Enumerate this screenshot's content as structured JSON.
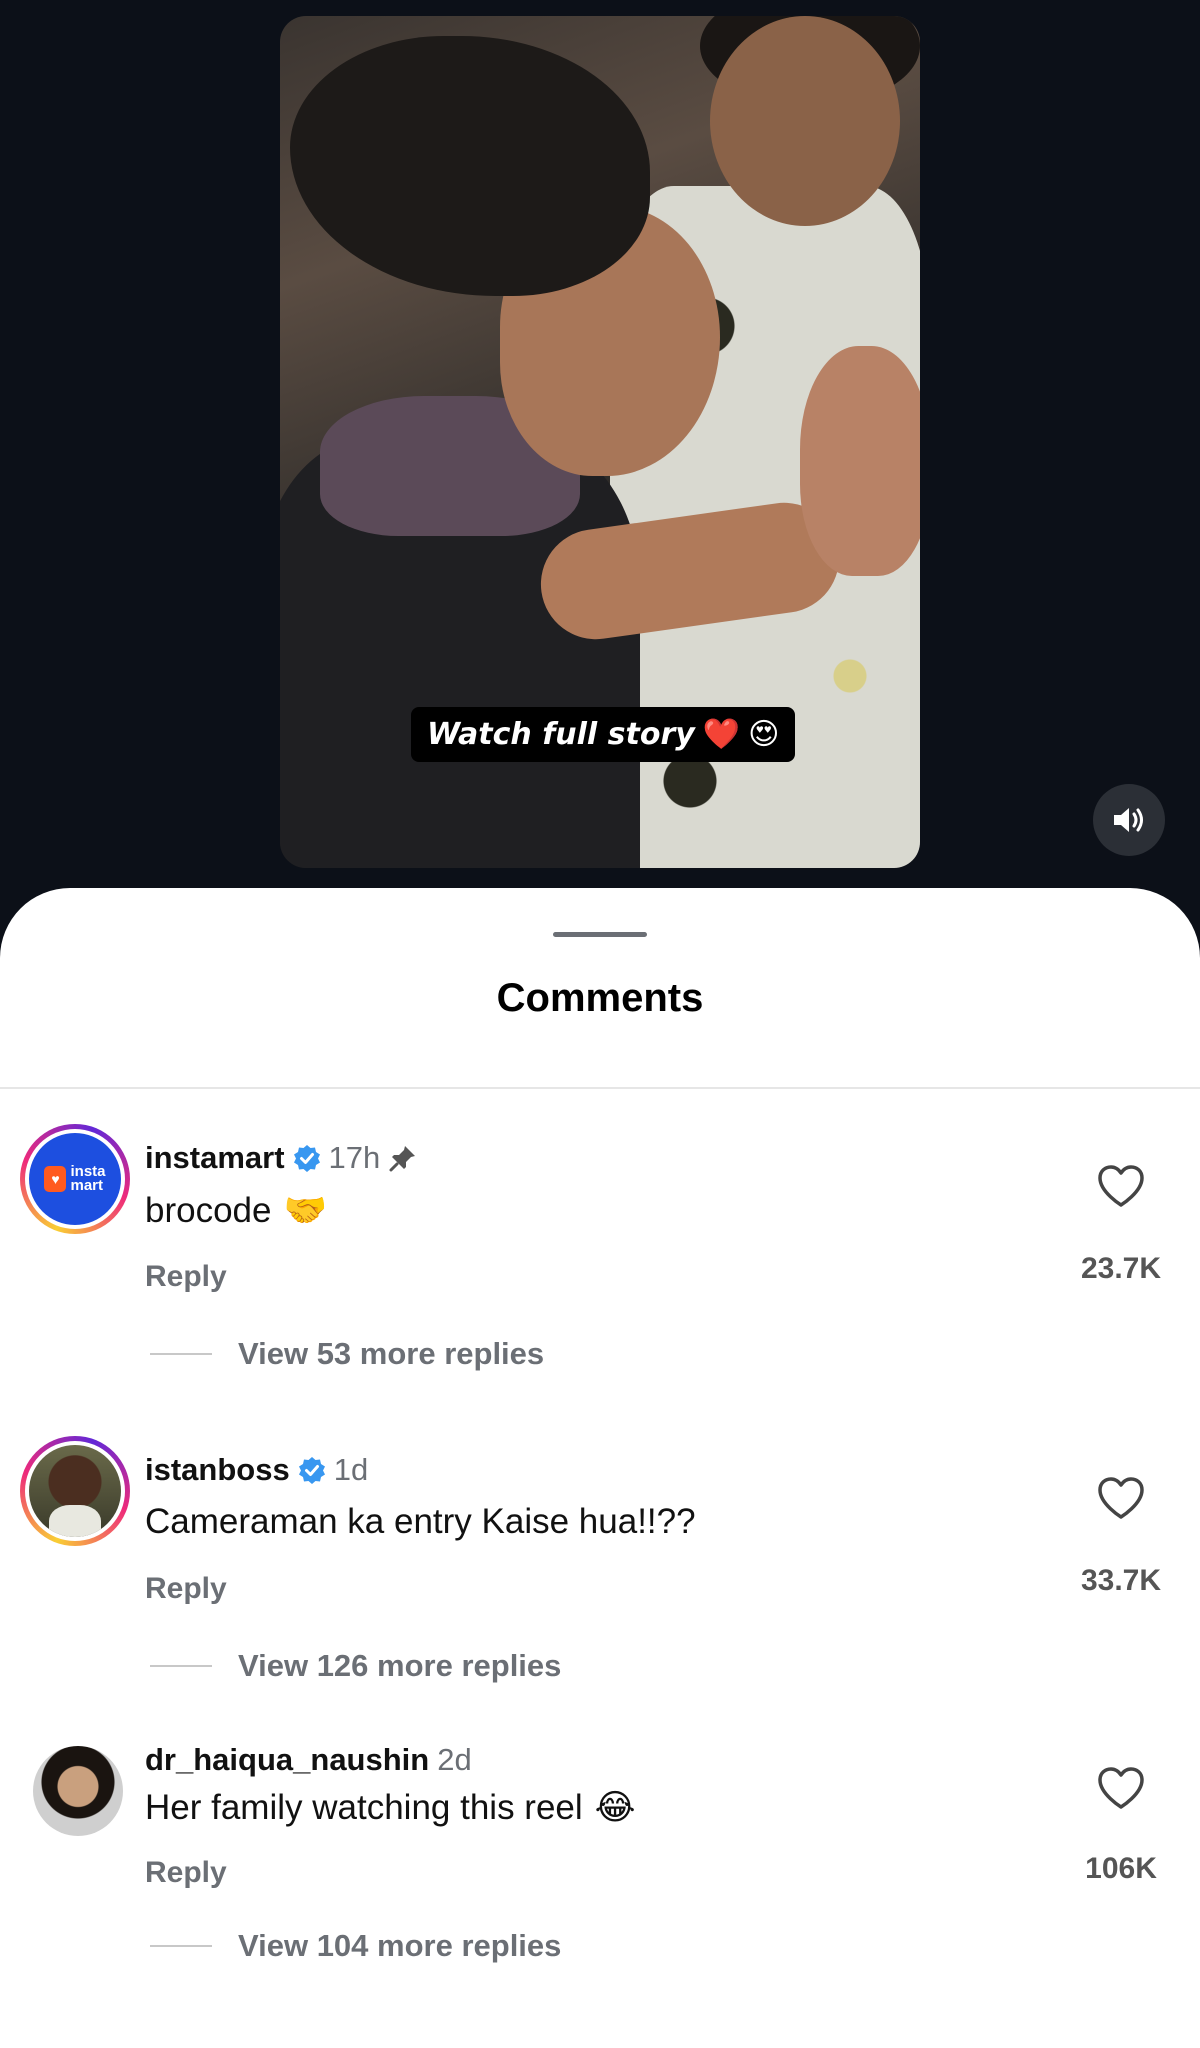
{
  "video": {
    "story_label": "Watch full story",
    "story_emojis": [
      "❤️",
      "😍"
    ],
    "sound_icon": "speaker-on-icon"
  },
  "sheet": {
    "title": "Comments"
  },
  "comments": [
    {
      "username": "instamart",
      "verified": true,
      "time": "17h",
      "pinned": true,
      "text": "brocode",
      "emoji": "🤝",
      "reply_label": "Reply",
      "likes": "23.7K",
      "view_more": "View 53 more replies",
      "avatar_text": "insta mart"
    },
    {
      "username": "istanboss",
      "verified": true,
      "time": "1d",
      "pinned": false,
      "text": "Cameraman ka entry Kaise hua!!??",
      "emoji": "",
      "reply_label": "Reply",
      "likes": "33.7K",
      "view_more": "View 126 more replies"
    },
    {
      "username": "dr_haiqua_naushin",
      "verified": false,
      "time": "2d",
      "pinned": false,
      "text": "Her family watching this reel",
      "emoji": "😂",
      "reply_label": "Reply",
      "likes": "106K",
      "view_more": "View 104 more replies"
    }
  ],
  "colors": {
    "background": "#0c1018",
    "sheet": "#ffffff",
    "verified_blue": "#3897f0",
    "secondary_text": "#6b6f75"
  }
}
